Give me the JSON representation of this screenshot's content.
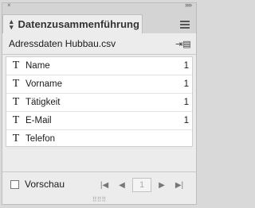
{
  "panel": {
    "title": "Datenzusammenführung",
    "tab_icon": "double-arrow-icon",
    "menu_icon": "panel-menu-icon",
    "collapse_glyph": "»»"
  },
  "file": {
    "name": "Adressdaten Hubbau.csv",
    "icon": "import-data-icon"
  },
  "fields": [
    {
      "type": "T",
      "label": "Name",
      "count": "1"
    },
    {
      "type": "T",
      "label": "Vorname",
      "count": "1"
    },
    {
      "type": "T",
      "label": "Tätigkeit",
      "count": "1"
    },
    {
      "type": "T",
      "label": "E-Mail",
      "count": "1"
    },
    {
      "type": "T",
      "label": "Telefon",
      "count": ""
    }
  ],
  "footer": {
    "preview_label": "Vorschau",
    "preview_checked": false,
    "page": "1"
  }
}
